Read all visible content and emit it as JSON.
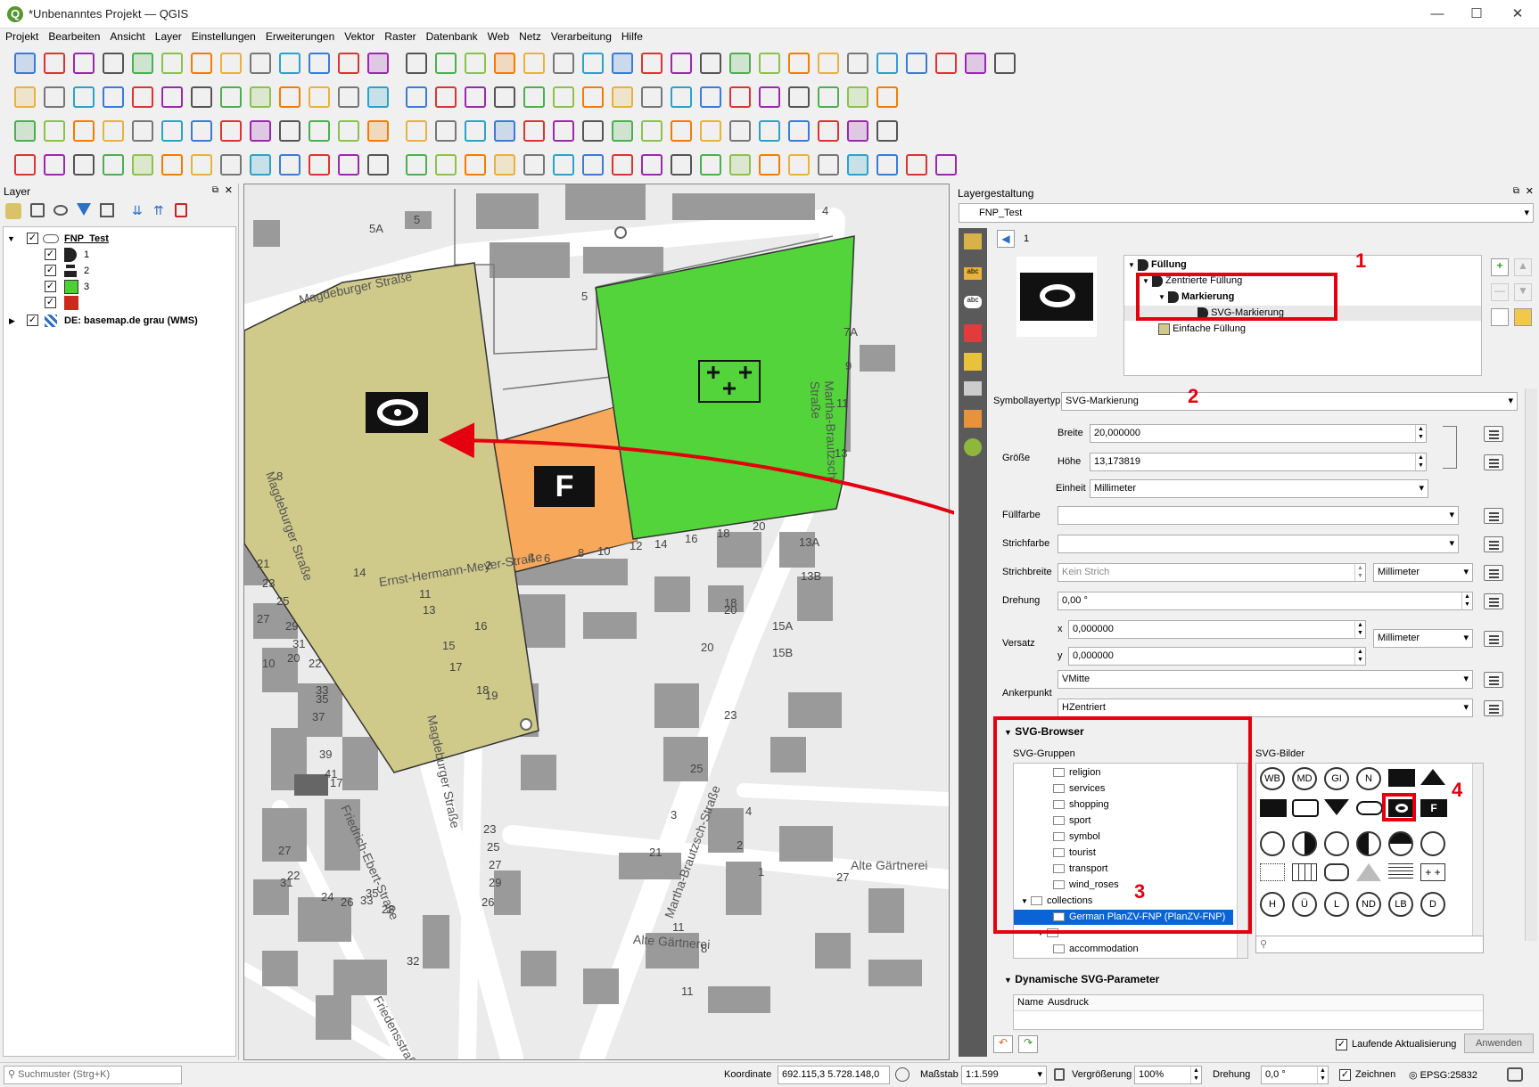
{
  "window": {
    "title": "*Unbenanntes Projekt — QGIS",
    "logo_letter": "Q",
    "minimize": "—",
    "maximize": "☐",
    "close": "✕"
  },
  "menu": [
    "Projekt",
    "Bearbeiten",
    "Ansicht",
    "Layer",
    "Einstellungen",
    "Erweiterungen",
    "Vektor",
    "Raster",
    "Datenbank",
    "Web",
    "Netz",
    "Verarbeitung",
    "Hilfe"
  ],
  "layers_panel": {
    "title": "Layer",
    "layers": [
      {
        "name": "FNP_Test",
        "checked": true,
        "expanded": true
      },
      {
        "name": "1",
        "checked": true,
        "sub": true,
        "color": "#222222"
      },
      {
        "name": "2",
        "checked": true,
        "sub": true,
        "color": "#222222"
      },
      {
        "name": "3",
        "checked": true,
        "sub": true,
        "color": "#4cd135"
      },
      {
        "name": "",
        "checked": true,
        "sub": true,
        "color": "#cc2a1c"
      },
      {
        "name": "DE: basemap.de grau (WMS)",
        "checked": true,
        "expanded": false
      }
    ]
  },
  "map": {
    "streets": [
      "Magdeburger Straße",
      "Magdeburger Straße",
      "Magdeburger Straße",
      "Martha-Brautzsch-Straße",
      "Martha-Brautzsch-Straße",
      "Ernst-Hermann-Meyer-Straße",
      "Alte Gärtnerei",
      "Alte Gärtnerei",
      "Friedrich-Ebert-Straße",
      "Friedensstraße"
    ],
    "house_numbers": [
      "5A",
      "5",
      "4",
      "5",
      "7A",
      "9",
      "11",
      "13",
      "8",
      "21",
      "23",
      "25",
      "27",
      "29",
      "31",
      "14",
      "2",
      "4",
      "6",
      "8",
      "10",
      "12",
      "14",
      "16",
      "18",
      "20",
      "13A",
      "13B",
      "11",
      "13",
      "15",
      "17",
      "16",
      "18",
      "20",
      "19",
      "18",
      "15A",
      "15B",
      "20",
      "10",
      "20",
      "22",
      "33",
      "35",
      "37",
      "39",
      "41",
      "17",
      "23",
      "25",
      "3",
      "4",
      "1",
      "2",
      "27",
      "21",
      "23",
      "25",
      "27",
      "29",
      "27",
      "31",
      "22",
      "24",
      "26",
      "28",
      "33",
      "35",
      "26",
      "11",
      "11",
      "8",
      "32"
    ],
    "label_F": "F",
    "label_plus": "+ +\n  +"
  },
  "style_panel": {
    "title": "Layergestaltung",
    "layer_combo": "FNP_Test",
    "page_index": "1",
    "tree": [
      {
        "label": "Füllung",
        "bold": true
      },
      {
        "label": "Zentrierte Füllung",
        "bold": false
      },
      {
        "label": "Markierung",
        "bold": true
      },
      {
        "label": "SVG-Markierung",
        "bold": false
      },
      {
        "label": "Einfache Füllung",
        "bold": false
      }
    ],
    "symbol_layer_type_label": "Symbollayertyp",
    "symbol_layer_type": "SVG-Markierung",
    "size_label": "Größe",
    "width_label": "Breite",
    "width_value": "20,000000",
    "height_label": "Höhe",
    "height_value": "13,173819",
    "unit_label": "Einheit",
    "unit_value": "Millimeter",
    "fill_color_label": "Füllfarbe",
    "stroke_color_label": "Strichfarbe",
    "stroke_width_label": "Strichbreite",
    "stroke_width_value": "Kein Strich",
    "stroke_unit": "Millimeter",
    "rotation_label": "Drehung",
    "rotation_value": "0,00 °",
    "offset_label": "Versatz",
    "offset_x_label": "x",
    "offset_x": "0,000000",
    "offset_y_label": "y",
    "offset_y": "0,000000",
    "offset_unit": "Millimeter",
    "anchor_label": "Ankerpunkt",
    "anchor_v": "VMitte",
    "anchor_h": "HZentriert",
    "svg_browser_title": "SVG-Browser",
    "svg_groups_label": "SVG-Gruppen",
    "svg_images_label": "SVG-Bilder",
    "svg_groups": [
      "religion",
      "services",
      "shopping",
      "sport",
      "symbol",
      "tourist",
      "transport",
      "wind_roses",
      "collections",
      "German PlanZV-FNP (PlanZV-FNP)",
      "",
      "accommodation"
    ],
    "svg_image_labels": [
      "WB",
      "MD",
      "GI",
      "N",
      "H",
      "Ü",
      "L",
      "ND",
      "LB",
      "D"
    ],
    "search_placeholder": "",
    "dynamic_params_title": "Dynamische SVG-Parameter",
    "col_name": "Name",
    "col_expr": "Ausdruck",
    "live_update_label": "Laufende Aktualisierung",
    "apply_button": "Anwenden"
  },
  "annotations": [
    "1",
    "2",
    "3",
    "4"
  ],
  "status": {
    "search_placeholder": "Suchmuster (Strg+K)",
    "coord_label": "Koordinate",
    "coord_value": "692.115,3  5.728.148,0",
    "scale_label": "Maßstab",
    "scale_value": "1:1.599",
    "magnifier_label": "Vergrößerung",
    "magnifier_value": "100%",
    "rotation_label": "Drehung",
    "rotation_value": "0,0 °",
    "render_label": "Zeichnen",
    "crs": "EPSG:25832"
  },
  "colors": {
    "accent_red": "#e4000f",
    "green_area": "#52d43a",
    "khaki_area": "#cfc98a",
    "orange_area": "#f8a95a",
    "selection": "#0a64d6"
  }
}
